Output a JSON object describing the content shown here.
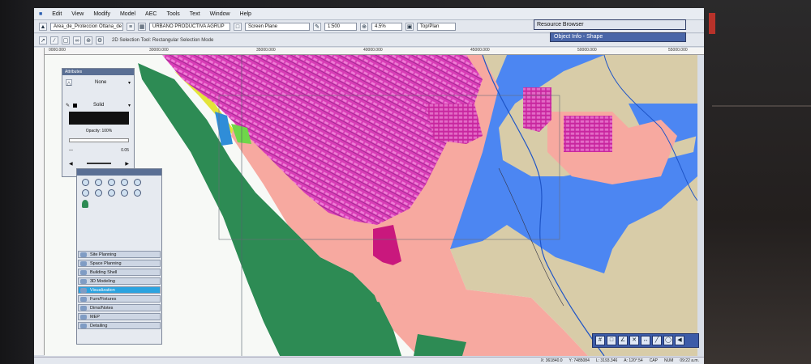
{
  "menu": [
    "Edit",
    "View",
    "Modify",
    "Model",
    "AEC",
    "Tools",
    "Text",
    "Window",
    "Help"
  ],
  "toolbar": {
    "layer_combo": "Area_de_Proteccion Ottana_de",
    "class_combo": "URBANO PRODUCTIVA AGRUP",
    "plane_combo": "Screen Plane",
    "scale_combo": "1:500",
    "zoom_combo": "4.5%",
    "view_combo": "Top/Plan",
    "mode_text": "2D Selection Tool: Rectangular Selection Mode"
  },
  "ruler": {
    "labels": [
      "0000.000",
      "30000.000",
      "35000.000",
      "40000.000",
      "45000.000",
      "50000.000",
      "55000.000"
    ]
  },
  "resource_browser": {
    "title": "Resource Browser"
  },
  "object_info": {
    "title": "Object Info - Shape"
  },
  "attributes": {
    "title": "Attributes",
    "fill": "None",
    "pen": "Solid",
    "opacity": "Opacity: 100%",
    "lineweight": "0.05"
  },
  "nav": [
    {
      "label": "Site Planning",
      "active": false
    },
    {
      "label": "Space Planning",
      "active": false
    },
    {
      "label": "Building Shell",
      "active": false
    },
    {
      "label": "3D Modeling",
      "active": false
    },
    {
      "label": "Visualization",
      "active": true
    },
    {
      "label": "Furn/Fixtures",
      "active": false
    },
    {
      "label": "Dims/Notes",
      "active": false
    },
    {
      "label": "MEP",
      "active": false
    },
    {
      "label": "Detailing",
      "active": false
    }
  ],
  "status": {
    "x": "X: 361840.0",
    "y": "Y: 7485084",
    "l": "L: 3193.346",
    "a": "A: 120°.54",
    "caps": "CAP",
    "num": "NUM",
    "time": "09:22 a.m."
  },
  "colors": {
    "urban": "#d83cb6",
    "river_zone": "#4c86f2",
    "salmon": "#f7a9a0",
    "green": "#2d8b54",
    "yellow": "#e3e339",
    "tan": "#d8cca8",
    "magenta_block": "#c9187d"
  }
}
